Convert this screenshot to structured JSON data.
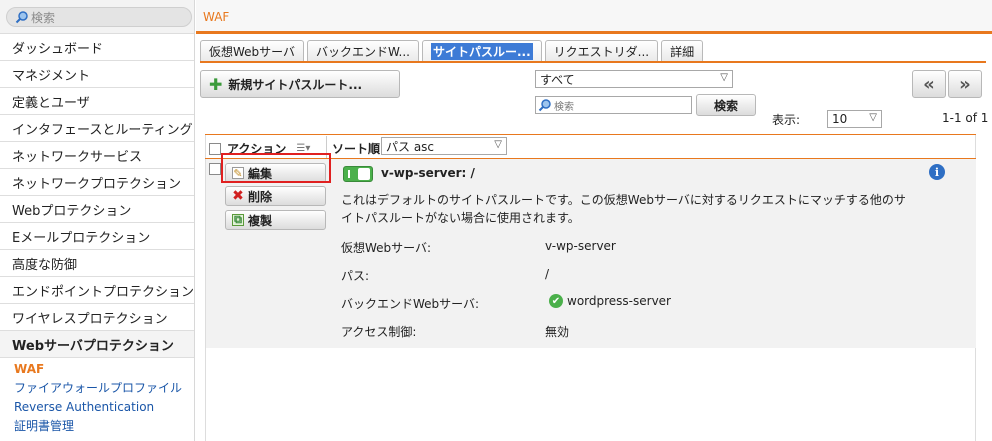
{
  "sidebar": {
    "search_placeholder": "検索",
    "items": [
      {
        "label": "ダッシュボード"
      },
      {
        "label": "マネジメント"
      },
      {
        "label": "定義とユーザ"
      },
      {
        "label": "インタフェースとルーティング"
      },
      {
        "label": "ネットワークサービス"
      },
      {
        "label": "ネットワークプロテクション"
      },
      {
        "label": "Webプロテクション"
      },
      {
        "label": "Eメールプロテクション"
      },
      {
        "label": "高度な防御"
      },
      {
        "label": "エンドポイントプロテクション"
      },
      {
        "label": "ワイヤレスプロテクション"
      },
      {
        "label": "Webサーバプロテクション"
      }
    ],
    "subitems": [
      {
        "label": "WAF"
      },
      {
        "label": "ファイアウォールプロファイル"
      },
      {
        "label": "Reverse Authentication"
      },
      {
        "label": "証明書管理"
      }
    ]
  },
  "header": {
    "title": "WAF"
  },
  "tabs": [
    {
      "label": "仮想Webサーバ"
    },
    {
      "label": "バックエンドW..."
    },
    {
      "label": "サイトパスルー..."
    },
    {
      "label": "リクエストリダ..."
    },
    {
      "label": "詳細"
    }
  ],
  "toolbar": {
    "new_button": "新規サイトパスルート...",
    "filter_value": "すべて",
    "search_placeholder": "検索",
    "search_button": "検索",
    "display_label": "表示:",
    "display_value": "10",
    "pager_text": "1-1 of 1",
    "prev_label": "«",
    "next_label": "»"
  },
  "grid": {
    "action_header": "アクション",
    "sort_label": "ソート順:",
    "sort_value": "パス asc"
  },
  "row": {
    "actions": {
      "edit": "編集",
      "delete": "削除",
      "clone": "複製"
    },
    "name": "v-wp-server: /",
    "description": "これはデフォルトのサイトパスルートです。この仮想Webサーバに対するリクエストにマッチする他のサイトパスルートがない場合に使用されます。",
    "fields": [
      {
        "label": "仮想Webサーバ:",
        "value": "v-wp-server"
      },
      {
        "label": "パス:",
        "value": "/"
      },
      {
        "label": "バックエンドWebサーバ:",
        "value": "wordpress-server"
      },
      {
        "label": "アクセス制御:",
        "value": "無効"
      }
    ]
  },
  "colors": {
    "accent": "#e8781e",
    "link": "#1a56a8",
    "highlight": "#e02020",
    "ok": "#4bb04b"
  }
}
